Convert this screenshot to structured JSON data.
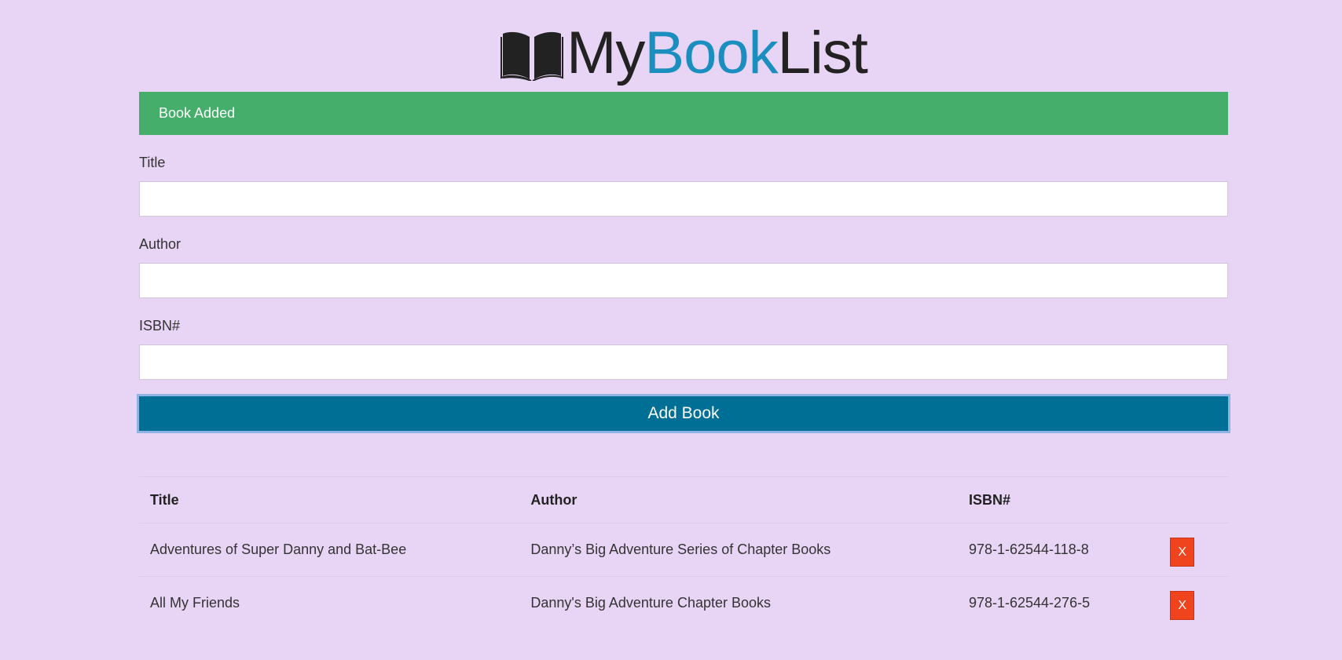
{
  "header": {
    "logo_icon": "open-book-icon",
    "logo_part1": "My",
    "logo_part2": "Book",
    "logo_part3": "List",
    "accent_color": "#1b8ec0"
  },
  "alert": {
    "message": "Book Added",
    "color": "#45ae6a"
  },
  "form": {
    "title_label": "Title",
    "title_value": "",
    "author_label": "Author",
    "author_value": "",
    "isbn_label": "ISBN#",
    "isbn_value": "",
    "submit_label": "Add Book",
    "submit_color": "#006f96"
  },
  "table": {
    "headers": [
      "Title",
      "Author",
      "ISBN#"
    ],
    "rows": [
      {
        "title": "Adventures of Super Danny and Bat-Bee",
        "author": "Danny’s Big Adventure Series of Chapter Books",
        "isbn": "978-1-62544-118-8",
        "delete_label": "X"
      },
      {
        "title": "All My Friends",
        "author": "Danny's Big Adventure Chapter Books",
        "isbn": "978-1-62544-276-5",
        "delete_label": "X"
      }
    ],
    "delete_color": "#f0441f"
  }
}
